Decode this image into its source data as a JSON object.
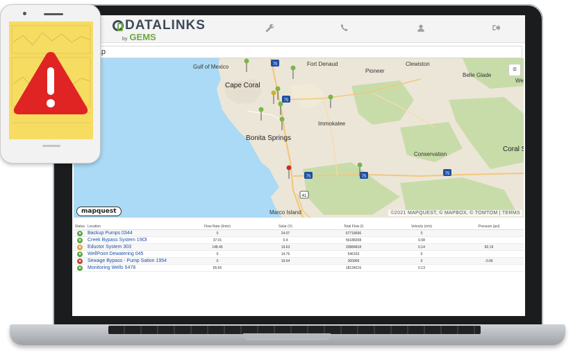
{
  "app": {
    "logo_text": "DATALINKS",
    "logo_by": "by",
    "logo_brand": "GEMS",
    "nav_icons": [
      "wrench-icon",
      "phone-icon",
      "user-icon",
      "logout-icon"
    ]
  },
  "map_panel": {
    "title": "le Map",
    "places": {
      "gulf": "Gulf of Mexico",
      "cape_coral": "Cape Coral",
      "fort_denaud": "Fort Denaud",
      "pioneer": "Pioneer",
      "clewiston": "Clewiston",
      "belle_glade": "Belle Glade",
      "we": "We",
      "immokalee": "Immokalee",
      "bonita_springs": "Bonita Springs",
      "conservation": "Conservation",
      "coral_sp": "Coral Sp",
      "marco_island": "Marco Island"
    },
    "highways": [
      "75",
      "75",
      "75",
      "75",
      "75",
      "41"
    ],
    "logo": "mapquest",
    "attribution": "©2021 MAPQUEST, © MAPBOX, © TOMTOM | TERMS",
    "layers_icon": "layers-icon",
    "pin_colors": {
      "ok": "#7ab648",
      "alarm": "#c0322b"
    }
  },
  "table": {
    "headers": [
      "Status",
      "Location",
      "Flow Rate (l/min)",
      "Solar (V)",
      "Total Flow (l)",
      "Velocity (m/s)",
      "Pressure (psi)"
    ],
    "rows": [
      {
        "status": "ok",
        "location": "Backup Pumps  0344",
        "flow_rate": "0",
        "solar": "24.07",
        "total_flow": "67718696",
        "velocity": "0",
        "pressure": ""
      },
      {
        "status": "ok",
        "location": "Creek Bypass System 19Ol",
        "flow_rate": "37.01",
        "solar": "0.4",
        "total_flow": "56188208",
        "velocity": "0.08",
        "pressure": ""
      },
      {
        "status": "warning",
        "location": "Eductor System 303",
        "flow_rate": "148.45",
        "solar": "19.63",
        "total_flow": "20884818",
        "velocity": "0.14",
        "pressure": "82.19"
      },
      {
        "status": "ok",
        "location": "WellPoint Dewatering 045",
        "flow_rate": "0",
        "solar": "14.76",
        "total_flow": "546163",
        "velocity": "0",
        "pressure": ""
      },
      {
        "status": "alarm",
        "location": "Sewage Bypass - Pump Sation 1954",
        "flow_rate": "0",
        "solar": "19.64",
        "total_flow": "300969",
        "velocity": "0",
        "pressure": "-0.06"
      },
      {
        "status": "ok",
        "location": "Monitoring Wells 5478",
        "flow_rate": "65.65",
        "solar": "",
        "total_flow": "18134215",
        "velocity": "0.13",
        "pressure": ""
      }
    ],
    "status_colors": {
      "ok": "#5aa845",
      "warning": "#e9a23b",
      "alarm": "#c9443a"
    }
  },
  "phone": {
    "alert_icon": "warning-triangle-icon",
    "alert_color": "#e02424",
    "screen_color": "#f7dc62"
  }
}
